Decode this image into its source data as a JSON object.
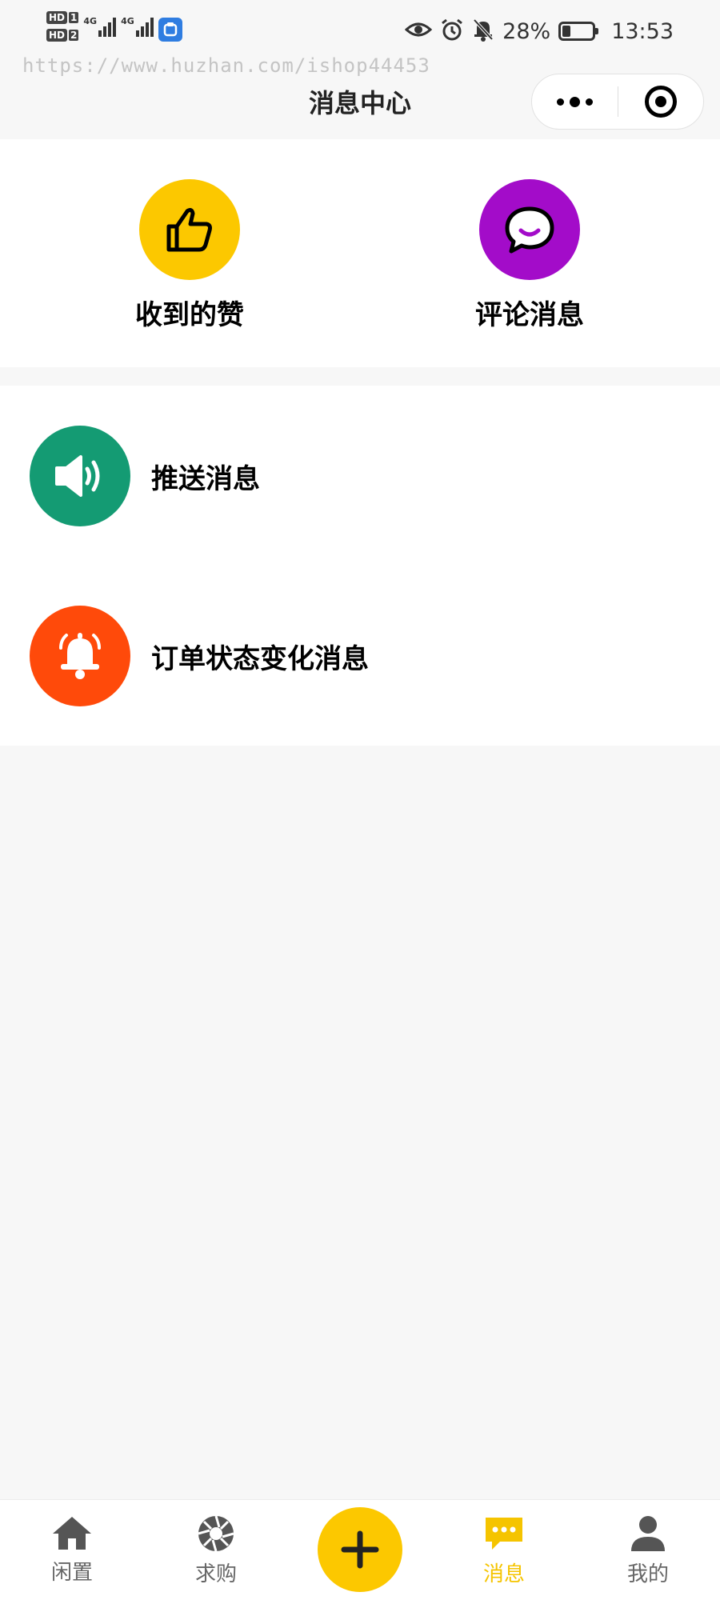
{
  "status_bar": {
    "sim1": "HD",
    "sim1_slot": "1",
    "sim2": "HD",
    "sim2_slot": "2",
    "net1": "4G",
    "net2": "4G",
    "battery": "28%",
    "time": "13:53",
    "battery_level": 0.28
  },
  "watermark": "https://www.huzhan.com/ishop44453",
  "nav": {
    "title": "消息中心"
  },
  "cards": [
    {
      "label": "收到的赞",
      "icon": "thumbs-up-icon",
      "color": "#FCC800"
    },
    {
      "label": "评论消息",
      "icon": "comment-icon",
      "color": "#A30CC9"
    }
  ],
  "list": [
    {
      "label": "推送消息",
      "icon": "speaker-icon",
      "color": "#149B73"
    },
    {
      "label": "订单状态变化消息",
      "icon": "bell-icon",
      "color": "#FF4A0A"
    }
  ],
  "tabbar": {
    "items": [
      {
        "label": "闲置",
        "icon": "home-icon",
        "active": false
      },
      {
        "label": "求购",
        "icon": "aperture-icon",
        "active": false
      },
      {
        "label": "消息",
        "icon": "message-icon",
        "active": true
      },
      {
        "label": "我的",
        "icon": "user-icon",
        "active": false
      }
    ],
    "publish_icon": "plus-icon",
    "active_color": "#F5C400",
    "inactive_color": "#666666"
  }
}
